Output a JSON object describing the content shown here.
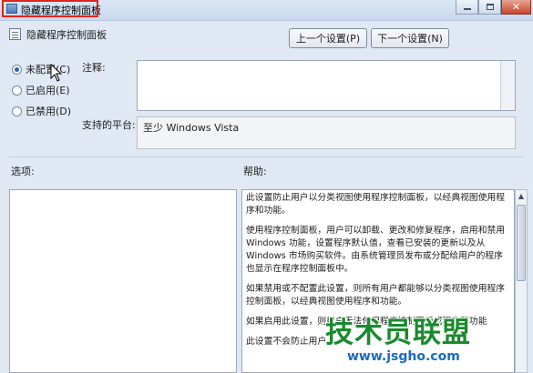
{
  "window": {
    "title": "隐藏程序控制面板",
    "controls": [
      "minimize-icon",
      "maximize-icon",
      "close-icon"
    ],
    "highlight_color": "#e0241b"
  },
  "setting": {
    "name": "隐藏程序控制面板"
  },
  "nav": {
    "prev_label": "上一个设置(P)",
    "next_label": "下一个设置(N)"
  },
  "state": {
    "options": [
      {
        "label": "未配置(C)",
        "selected": true
      },
      {
        "label": "已启用(E)",
        "selected": false
      },
      {
        "label": "已禁用(D)",
        "selected": false
      }
    ]
  },
  "comment": {
    "label": "注释:",
    "value": ""
  },
  "platform": {
    "label": "支持的平台:",
    "value": "至少 Windows Vista"
  },
  "options_section": {
    "label": "选项:"
  },
  "help": {
    "label": "帮助:",
    "paragraphs": [
      "此设置防止用户以分类视图使用程序控制面板，以经典视图使用程序和功能。",
      "使用程序控制面板，用户可以卸载、更改和修复程序，启用和禁用 Windows 功能，设置程序默认值，查看已安装的更新以及从 Windows 市场购买软件。由系统管理员发布或分配给用户的程序也显示在程序控制面板中。",
      "如果禁用或不配置此设置，则所有用户都能够以分类视图使用程序控制面板，以经典视图使用程序和功能。",
      "如果启用此设置，则用户无法使用程序控制面板或程序和功能",
      "此设置不会防止用户"
    ]
  },
  "watermark": {
    "text": "技术员联盟",
    "url": "www.jsgho.com"
  }
}
